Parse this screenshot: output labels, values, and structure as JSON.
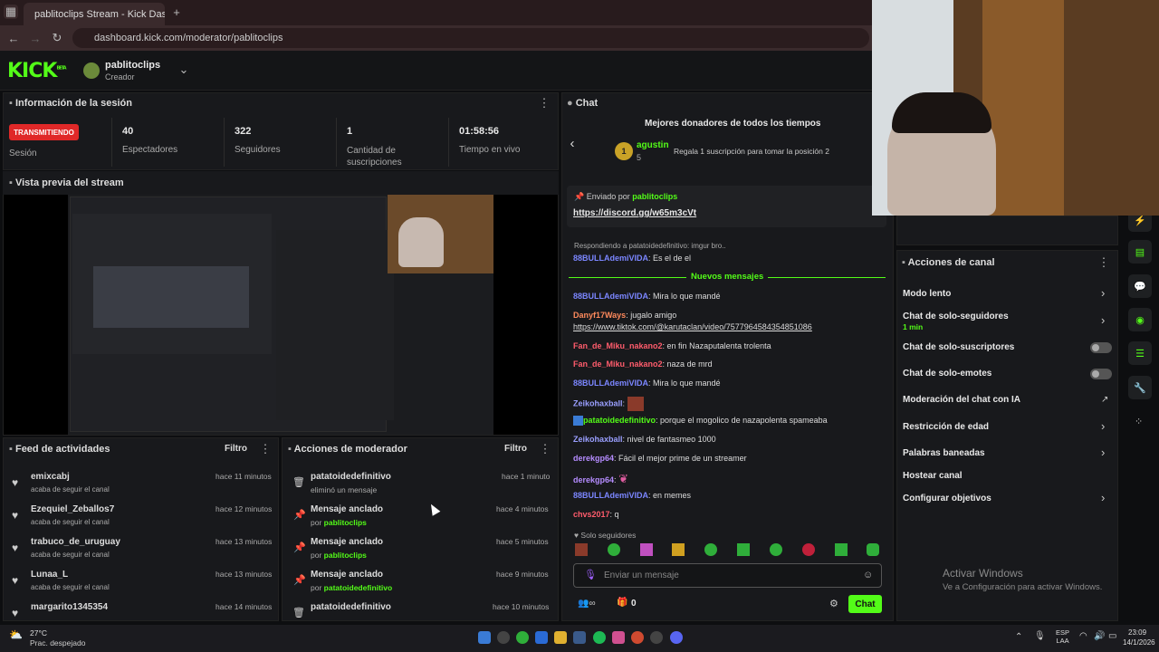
{
  "browser": {
    "tab_title": "pablitoclips Stream - Kick Dashb",
    "url": "dashboard.kick.com/moderator/pablitoclips"
  },
  "header": {
    "logo": "KICK",
    "beta": "BETA",
    "username": "pablitoclips",
    "role": "Creador"
  },
  "session": {
    "title": "Información de la sesión",
    "status": "TRANSMITIENDO",
    "status_label": "Sesión",
    "stats": [
      {
        "value": "40",
        "label": "Espectadores"
      },
      {
        "value": "322",
        "label": "Seguidores"
      },
      {
        "value": "1",
        "label": "Cantidad de suscripciones"
      },
      {
        "value": "01:58:56",
        "label": "Tiempo en vivo"
      }
    ]
  },
  "preview": {
    "title": "Vista previa del stream"
  },
  "feed": {
    "title": "Feed de actividades",
    "filter": "Filtro",
    "items": [
      {
        "name": "emixcabj",
        "desc": "acaba de seguir el canal",
        "time": "hace 11 minutos"
      },
      {
        "name": "Ezequiel_Zeballos7",
        "desc": "acaba de seguir el canal",
        "time": "hace 12 minutos"
      },
      {
        "name": "trabuco_de_uruguay",
        "desc": "acaba de seguir el canal",
        "time": "hace 13 minutos"
      },
      {
        "name": "Lunaa_L",
        "desc": "acaba de seguir el canal",
        "time": "hace 13 minutos"
      },
      {
        "name": "margarito1345354",
        "desc": "",
        "time": "hace 14 minutos"
      }
    ]
  },
  "mod": {
    "title": "Acciones de moderador",
    "filter": "Filtro",
    "items": [
      {
        "name": "patatoidedefinitivo",
        "desc": "eliminó un mensaje",
        "by": "",
        "time": "hace 1 minuto"
      },
      {
        "name": "Mensaje anclado",
        "desc": "por ",
        "by": "pablitoclips",
        "time": "hace 4 minutos"
      },
      {
        "name": "Mensaje anclado",
        "desc": "por ",
        "by": "pablitoclips",
        "time": "hace 5 minutos"
      },
      {
        "name": "Mensaje anclado",
        "desc": "por ",
        "by": "patatoidedefinitivo",
        "time": "hace 9 minutos"
      },
      {
        "name": "patatoidedefinitivo",
        "desc": "",
        "by": "",
        "time": "hace 10 minutos"
      }
    ]
  },
  "chat": {
    "title": "Chat",
    "donors_title": "Mejores donadores de todos los tiempos",
    "donor": "agustin",
    "donor_count": "5",
    "donor_rank": "1",
    "donor_cta": "Regala 1 suscripción para tomar la posición 2",
    "pinned_by": "Enviado por",
    "pinned_user": "pablitoclips",
    "pinned_link": "https://discord.gg/w65m3cVt",
    "reply_note": "Respondiendo a patatoidedefinitivo: imgur bro..",
    "new_messages": "Nuevos mensajes",
    "messages": [
      {
        "user": "88BULLAdemiVIDA",
        "text": ": Es el de el",
        "color": "#7b86ff"
      },
      {
        "user": "88BULLAdemiVIDA",
        "text": ": Mira lo que mandé",
        "color": "#7b86ff"
      },
      {
        "user": "Danyf17Ways",
        "text": ": jugalo amigo",
        "color": "#ff8a5c"
      },
      {
        "user": "",
        "text": "https://www.tiktok.com/@karutaclan/video/7577964584354851086",
        "color": "#ddd"
      },
      {
        "user": "Fan_de_Miku_nakano2",
        "text": ": en fin Nazaputalenta trolenta",
        "color": "#ff5c6c"
      },
      {
        "user": "Fan_de_Miku_nakano2",
        "text": ": naza de mrd",
        "color": "#ff5c6c"
      },
      {
        "user": "88BULLAdemiVIDA",
        "text": ": Mira lo que mandé",
        "color": "#7b86ff"
      },
      {
        "user": "Zeikohaxball",
        "text": ":",
        "color": "#9a9fff"
      },
      {
        "user": "patatoidedefinitivo",
        "text": ": porque el mogolico de nazapolenta spameaba",
        "color": "#53fc18"
      },
      {
        "user": "Zeikohaxball",
        "text": ": nivel de fantasmeo 1000",
        "color": "#9a9fff"
      },
      {
        "user": "derekgp64",
        "text": ": Fácil el mejor prime de un streamer",
        "color": "#b58cff"
      },
      {
        "user": "derekgp64",
        "text": ":",
        "color": "#b58cff"
      },
      {
        "user": "88BULLAdemiVIDA",
        "text": ": en memes",
        "color": "#7b86ff"
      },
      {
        "user": "chvs2017",
        "text": ": q",
        "color": "#ff5c6c"
      }
    ],
    "followers_only": "Solo seguidores",
    "input_placeholder": "Enviar un mensaje",
    "count": "0",
    "send": "Chat"
  },
  "actions": {
    "title": "Acciones de canal",
    "items": [
      {
        "label": "Modo lento",
        "sub": "",
        "kind": "chevron"
      },
      {
        "label": "Chat de solo-seguidores",
        "sub": "1 min",
        "kind": "chevron"
      },
      {
        "label": "Chat de solo-suscriptores",
        "sub": "",
        "kind": "toggle"
      },
      {
        "label": "Chat de solo-emotes",
        "sub": "",
        "kind": "toggle"
      },
      {
        "label": "Moderación del chat con IA",
        "sub": "",
        "kind": "ai"
      },
      {
        "label": "Restricción de edad",
        "sub": "",
        "kind": "chevron"
      },
      {
        "label": "Palabras baneadas",
        "sub": "",
        "kind": "chevron"
      },
      {
        "label": "Hostear canal",
        "sub": "",
        "kind": "none"
      },
      {
        "label": "Configurar objetivos",
        "sub": "",
        "kind": "chevron"
      }
    ]
  },
  "windows": {
    "activate_title": "Activar Windows",
    "activate_sub": "Ve a Configuración para activar Windows."
  },
  "taskbar": {
    "temp": "27°C",
    "weather": "Prac. despejado",
    "lang1": "ESP",
    "lang2": "LAA",
    "time": "23:09",
    "date": "14/1/2026"
  },
  "colors": {
    "accent": "#53fc18",
    "live": "#e02828"
  }
}
